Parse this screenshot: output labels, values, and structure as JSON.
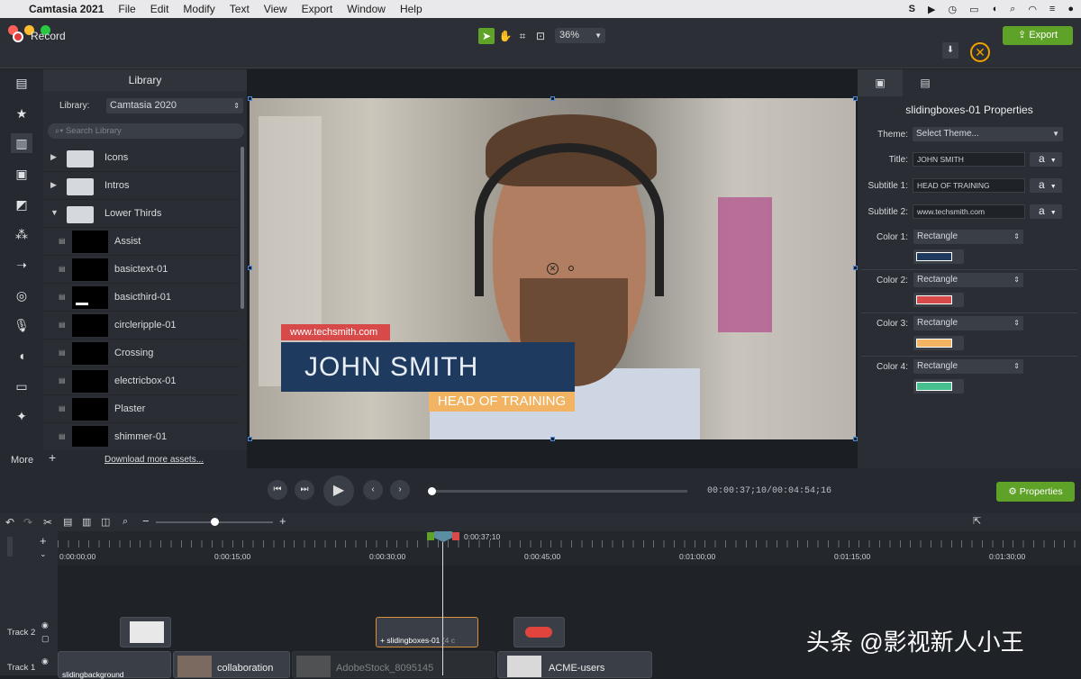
{
  "menubar": {
    "app": "Camtasia 2021",
    "items": [
      "File",
      "Edit",
      "Modify",
      "Text",
      "View",
      "Export",
      "Window",
      "Help"
    ]
  },
  "toolbar": {
    "record": "Record",
    "zoom": "36%",
    "export": "Export"
  },
  "library": {
    "title": "Library",
    "library_label": "Library:",
    "library_value": "Camtasia 2020",
    "search_placeholder": "Search Library",
    "folders": [
      "Icons",
      "Intros",
      "Lower Thirds"
    ],
    "items": [
      "Assist",
      "basictext-01",
      "basicthird-01",
      "circleripple-01",
      "Crossing",
      "electricbox-01",
      "Plaster",
      "shimmer-01"
    ],
    "more": "More",
    "download": "Download more assets..."
  },
  "video": {
    "url_text": "www.techsmith.com",
    "name": "JOHN SMITH",
    "role": "HEAD OF TRAINING"
  },
  "properties": {
    "title": "slidingboxes-01 Properties",
    "theme_label": "Theme:",
    "theme_value": "Select Theme...",
    "title_label": "Title:",
    "title_value": "JOHN SMITH",
    "subtitle1_label": "Subtitle 1:",
    "subtitle1_value": "HEAD OF TRAINING",
    "subtitle2_label": "Subtitle 2:",
    "subtitle2_value": "www.techsmith.com",
    "font_btn": "a",
    "colors": [
      {
        "label": "Color 1:",
        "type": "Rectangle",
        "color": "#1f3a5f"
      },
      {
        "label": "Color 2:",
        "type": "Rectangle",
        "color": "#d84a4a"
      },
      {
        "label": "Color 3:",
        "type": "Rectangle",
        "color": "#f2b462"
      },
      {
        "label": "Color 4:",
        "type": "Rectangle",
        "color": "#46c08f"
      }
    ],
    "properties_button": "Properties"
  },
  "playback": {
    "time_current": "00:00:37;10",
    "time_total": "00:04:54;16",
    "progress": 0.0
  },
  "timeline": {
    "playhead_time": "0:00:37;10",
    "ticks": [
      "0:00:00;00",
      "0:00:15;00",
      "0:00:30;00",
      "0:00:45;00",
      "0:01:00;00",
      "0:01:15;00",
      "0:01:30;00"
    ],
    "track2": "Track 2",
    "track1": "Track 1",
    "clips": {
      "sliding": "slidingboxes-01",
      "sliding_suffix": "(4 c",
      "collab": "collaboration",
      "adobe": "AdobeStock_8095145",
      "acme": "ACME-users",
      "slidingbg": "slidingbackground"
    }
  },
  "watermark": "头条 @影视新人小王"
}
